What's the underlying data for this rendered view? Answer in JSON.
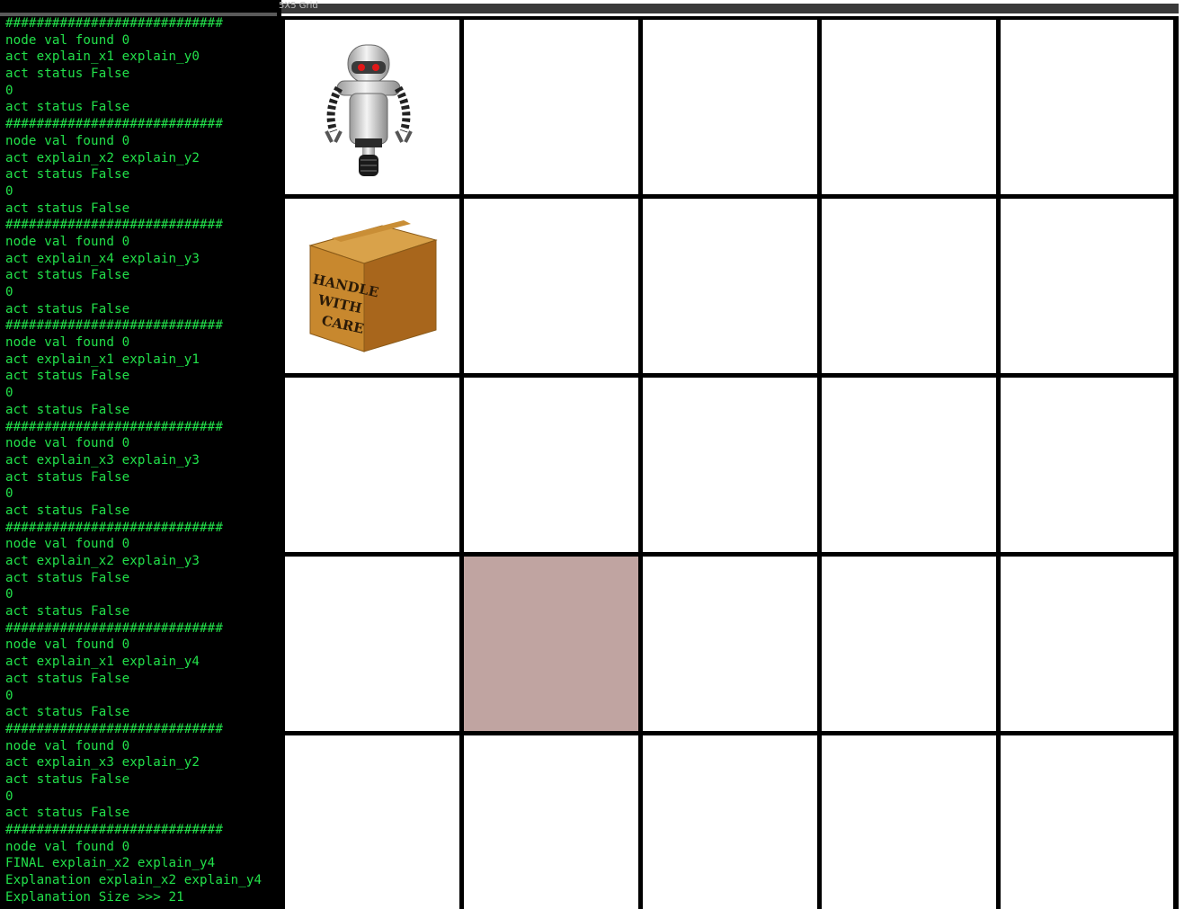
{
  "terminal": {
    "lines": [
      "############################",
      "node val found 0",
      "act explain_x1 explain_y0",
      "act status False",
      "0",
      "act status False",
      "############################",
      "node val found 0",
      "act explain_x2 explain_y2",
      "act status False",
      "0",
      "act status False",
      "############################",
      "node val found 0",
      "act explain_x4 explain_y3",
      "act status False",
      "0",
      "act status False",
      "############################",
      "node val found 0",
      "act explain_x1 explain_y1",
      "act status False",
      "0",
      "act status False",
      "############################",
      "node val found 0",
      "act explain_x3 explain_y3",
      "act status False",
      "0",
      "act status False",
      "############################",
      "node val found 0",
      "act explain_x2 explain_y3",
      "act status False",
      "0",
      "act status False",
      "############################",
      "node val found 0",
      "act explain_x1 explain_y4",
      "act status False",
      "0",
      "act status False",
      "############################",
      "node val found 0",
      "act explain_x3 explain_y2",
      "act status False",
      "0",
      "act status False",
      "############################",
      "node val found 0",
      "FINAL explain_x2 explain_y4",
      "Explanation explain_x2 explain_y4",
      "Explanation Size >>> 21"
    ]
  },
  "grid": {
    "title": "5X5 Grid",
    "rows": 5,
    "cols": 5,
    "highlight_color": "#c0a4a1",
    "highlighted_cell": {
      "row": 3,
      "col": 1
    },
    "robot": {
      "row": 0,
      "col": 0,
      "icon": "robot-icon"
    },
    "box": {
      "row": 1,
      "col": 0,
      "icon": "box-icon",
      "label_lines": [
        "HANDLE",
        "WITH",
        "CARE"
      ]
    }
  }
}
